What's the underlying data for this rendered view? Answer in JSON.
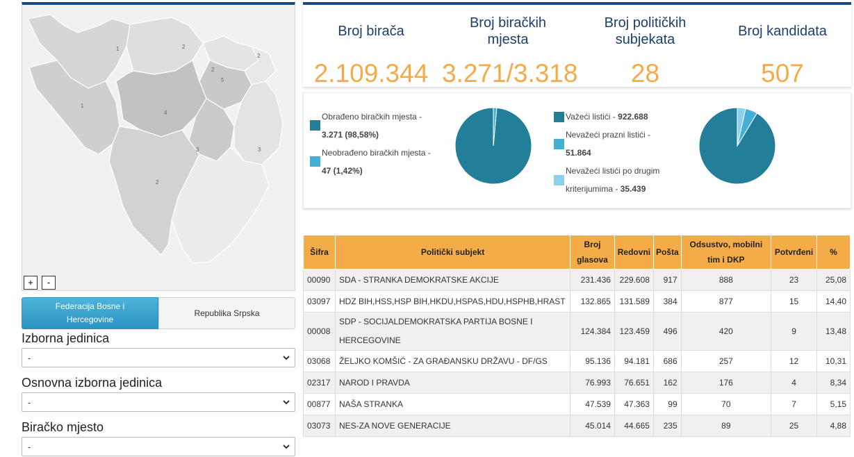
{
  "map": {
    "region_labels": [
      "1",
      "2",
      "2",
      "2",
      "5",
      "1",
      "4",
      "3",
      "3",
      "2"
    ],
    "zoom_in": "+",
    "zoom_out": "-"
  },
  "entity_tabs": {
    "fbih": "Federacija Bosne i Hercegovine",
    "rs": "Republika Srpska"
  },
  "filters": {
    "izborna_label": "Izborna jedinica",
    "izborna_value": "-",
    "osnovna_label": "Osnovna izborna jedinica",
    "osnovna_value": "-",
    "mjesto_label": "Biračko mjesto",
    "mjesto_value": "-"
  },
  "stats": {
    "voters_label": "Broj birača",
    "voters_value": "2.109.344",
    "polling_label": "Broj biračkih mjesta",
    "polling_value": "3.271/3.318",
    "subjects_label": "Broj političkih subjekata",
    "subjects_value": "28",
    "candidates_label": "Broj kandidata",
    "candidates_value": "507"
  },
  "pie1": {
    "processed_label": "Obrađeno biračkih mjesta -",
    "processed_value": "3.271 (98,58%)",
    "unprocessed_label": "Neobrađeno biračkih mjesta -",
    "unprocessed_value": "47 (1,42%)",
    "fractions": [
      0.9858,
      0.0142
    ]
  },
  "pie2": {
    "valid_label": "Važeći listići -",
    "valid_value": "922.688",
    "empty_label": "Nevažeći prazni listići -",
    "empty_value": "51.864",
    "other_label": "Nevažeći listići po drugim kriterijumima -",
    "other_value": "35.439",
    "values": [
      922688,
      51864,
      35439
    ]
  },
  "colors": {
    "dark_teal": "#237f99",
    "mid_blue": "#45b0d6",
    "light_blue": "#8fcfee",
    "orange": "#f4ac48",
    "navy": "#1e4a7a"
  },
  "table": {
    "headers": [
      "Šifra",
      "Politički subjekt",
      "Broj glasova",
      "Redovni",
      "Pošta",
      "Odsustvo, mobilni tim i DKP",
      "Potvrđeni",
      "%"
    ],
    "rows": [
      [
        "00090",
        "SDA - STRANKA DEMOKRATSKE AKCIJE",
        "231.436",
        "229.608",
        "917",
        "888",
        "23",
        "25,08"
      ],
      [
        "03097",
        "HDZ BIH,HSS,HSP BIH,HKDU,HSPAS,HDU,HSPHB,HRAST",
        "132.865",
        "131.589",
        "384",
        "877",
        "15",
        "14,40"
      ],
      [
        "00008",
        "SDP - SOCIJALDEMOKRATSKA PARTIJA BOSNE I HERCEGOVINE",
        "124.384",
        "123.459",
        "496",
        "420",
        "9",
        "13,48"
      ],
      [
        "03068",
        "ŽELJKO KOMŠIĆ - ZA GRAĐANSKU DRŽAVU - DF/GS",
        "95.136",
        "94.181",
        "686",
        "257",
        "12",
        "10,31"
      ],
      [
        "02317",
        "NAROD I PRAVDA",
        "76.993",
        "76.651",
        "162",
        "176",
        "4",
        "8,34"
      ],
      [
        "00877",
        "NAŠA STRANKA",
        "47.539",
        "47.363",
        "99",
        "70",
        "7",
        "5,15"
      ],
      [
        "03073",
        "NES-ZA NOVE GENERACIJE",
        "45.014",
        "44.665",
        "235",
        "89",
        "25",
        "4,88"
      ]
    ]
  }
}
